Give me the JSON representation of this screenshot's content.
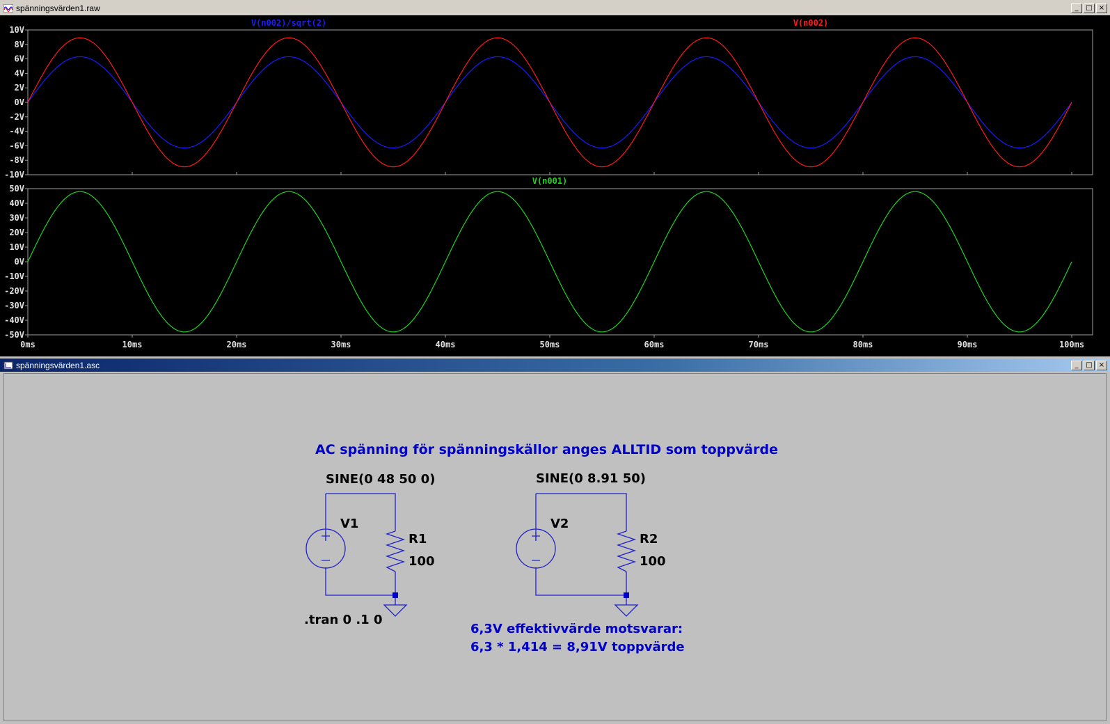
{
  "waveform_window": {
    "title": "spänningsvärden1.raw",
    "buttons": {
      "minimize": "_",
      "maximize": "□",
      "close": "×"
    },
    "traces": [
      {
        "label": "V(n002)/sqrt(2)",
        "color": "#1a1aff"
      },
      {
        "label": "V(n002)",
        "color": "#ff1a1a"
      },
      {
        "label": "V(n001)",
        "color": "#1fd41f"
      }
    ],
    "x_ticks": [
      "0ms",
      "10ms",
      "20ms",
      "30ms",
      "40ms",
      "50ms",
      "60ms",
      "70ms",
      "80ms",
      "90ms",
      "100ms"
    ],
    "top_y_ticks": [
      "10V",
      "8V",
      "6V",
      "4V",
      "2V",
      "0V",
      "-2V",
      "-4V",
      "-6V",
      "-8V",
      "-10V"
    ],
    "bottom_y_ticks": [
      "50V",
      "40V",
      "30V",
      "20V",
      "10V",
      "0V",
      "-10V",
      "-20V",
      "-30V",
      "-40V",
      "-50V"
    ]
  },
  "chart_data": [
    {
      "type": "line",
      "xlim": [
        0,
        100
      ],
      "ylim": [
        -10,
        10
      ],
      "grid": false,
      "series": [
        {
          "name": "V(n002)/sqrt(2)",
          "amplitude": 6.3,
          "frequency_hz": 50,
          "color": "#1a1aff"
        },
        {
          "name": "V(n002)",
          "amplitude": 8.91,
          "frequency_hz": 50,
          "color": "#ff1a1a"
        }
      ]
    },
    {
      "type": "line",
      "xlim": [
        0,
        100
      ],
      "ylim": [
        -50,
        50
      ],
      "grid": false,
      "series": [
        {
          "name": "V(n001)",
          "amplitude": 48,
          "frequency_hz": 50,
          "color": "#1fd41f"
        }
      ]
    }
  ],
  "schematic_window": {
    "title": "spänningsvärden1.asc",
    "buttons": {
      "minimize": "_",
      "maximize": "□",
      "close": "×"
    },
    "heading": "AC spänning för spänningskällor anges ALLTID som toppvärde",
    "circuit1": {
      "source_value": "SINE(0 48 50 0)",
      "source_name": "V1",
      "resistor_name": "R1",
      "resistor_value": "100"
    },
    "circuit2": {
      "source_value": "SINE(0 8.91 50)",
      "source_name": "V2",
      "resistor_name": "R2",
      "resistor_value": "100"
    },
    "directive": ".tran 0 .1 0",
    "note_line1": "6,3V effektivvärde motsvarar:",
    "note_line2": "6,3 *  1,414 = 8,91V toppvärde",
    "colors": {
      "wire": "#2020c8",
      "text_blue": "#0000c8",
      "text_black": "#000000"
    }
  }
}
